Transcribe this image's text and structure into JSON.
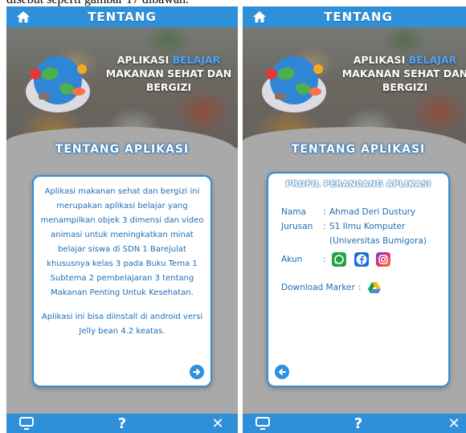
{
  "caption": "disebut seperti gambar 17 dibawah.",
  "left": {
    "topbar_title": "TENTANG",
    "app_title": {
      "line1_pre": "APLIKASI ",
      "line1_hl": "BELAJAR",
      "line2": "MAKANAN SEHAT DAN",
      "line3": "BERGIZI"
    },
    "section_title": "TENTANG APLIKASI",
    "paragraph1": "Aplikasi makanan sehat dan bergizi ini merupakan aplikasi belajar yang menampilkan objek 3 dimensi dan video animasi untuk meningkatkan minat belajar siswa di SDN 1 Barejulat khususnya kelas 3 pada Buku Tema 1 Subtema 2 pembelajaran 3 tentang Makanan Penting Untuk Kesehatan.",
    "paragraph2": "Aplikasi ini bisa diinstall di android versi Jelly bean 4.2 keatas."
  },
  "right": {
    "topbar_title": "TENTANG",
    "app_title": {
      "line1_pre": "APLIKASI ",
      "line1_hl": "BELAJAR",
      "line2": "MAKANAN SEHAT DAN",
      "line3": "BERGIZI"
    },
    "section_title": "TENTANG APLIKASI",
    "profile_title": "PROFIL PERANCANG APLIKASI",
    "nama_label": "Nama",
    "nama_value": "Ahmad Deri Dustury",
    "jurusan_label": "Jurusan",
    "jurusan_value": "S1 Ilmu Komputer",
    "jurusan_value2": "(Universitas Bumigora)",
    "akun_label": "Akun",
    "download_label": "Download Marker"
  },
  "colors": {
    "accent": "#2f8fd8",
    "text_blue": "#1e6eb5"
  }
}
